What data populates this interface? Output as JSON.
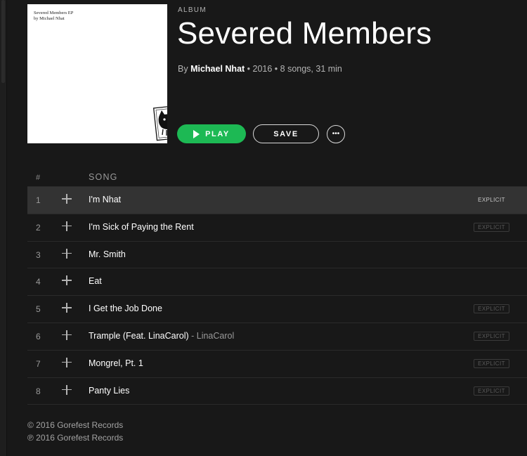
{
  "album": {
    "cover_text_line1": "Severed Members EP",
    "cover_text_line2": "by Michael Nhat",
    "type_label": "ALBUM",
    "title": "Severed Members",
    "by_prefix": "By",
    "artist": "Michael Nhat",
    "details": " • 2016 • 8 songs, 31 min"
  },
  "actions": {
    "play_label": "PLAY",
    "save_label": "SAVE",
    "more_label": "•••"
  },
  "table": {
    "col_number": "#",
    "col_song": "SONG"
  },
  "tracks": [
    {
      "number": "1",
      "title": "I'm Nhat",
      "featured": "",
      "explicit": "EXPLICIT",
      "active": true
    },
    {
      "number": "2",
      "title": "I'm Sick of Paying the Rent",
      "featured": "",
      "explicit": "EXPLICIT"
    },
    {
      "number": "3",
      "title": "Mr. Smith",
      "featured": "",
      "explicit": ""
    },
    {
      "number": "4",
      "title": "Eat",
      "featured": "",
      "explicit": ""
    },
    {
      "number": "5",
      "title": "I Get the Job Done",
      "featured": "",
      "explicit": "EXPLICIT"
    },
    {
      "number": "6",
      "title": "Trample (Feat. LinaCarol)",
      "featured": " - LinaCarol",
      "explicit": "EXPLICIT"
    },
    {
      "number": "7",
      "title": "Mongrel, Pt. 1",
      "featured": "",
      "explicit": "EXPLICIT"
    },
    {
      "number": "8",
      "title": "Panty Lies",
      "featured": "",
      "explicit": "EXPLICIT"
    }
  ],
  "footer": {
    "copyright": "© 2016 Gorefest Records",
    "phonogram": "℗ 2016 Gorefest Records"
  },
  "colors": {
    "background": "#181818",
    "accent_green": "#1db954",
    "active_row": "#333333"
  }
}
